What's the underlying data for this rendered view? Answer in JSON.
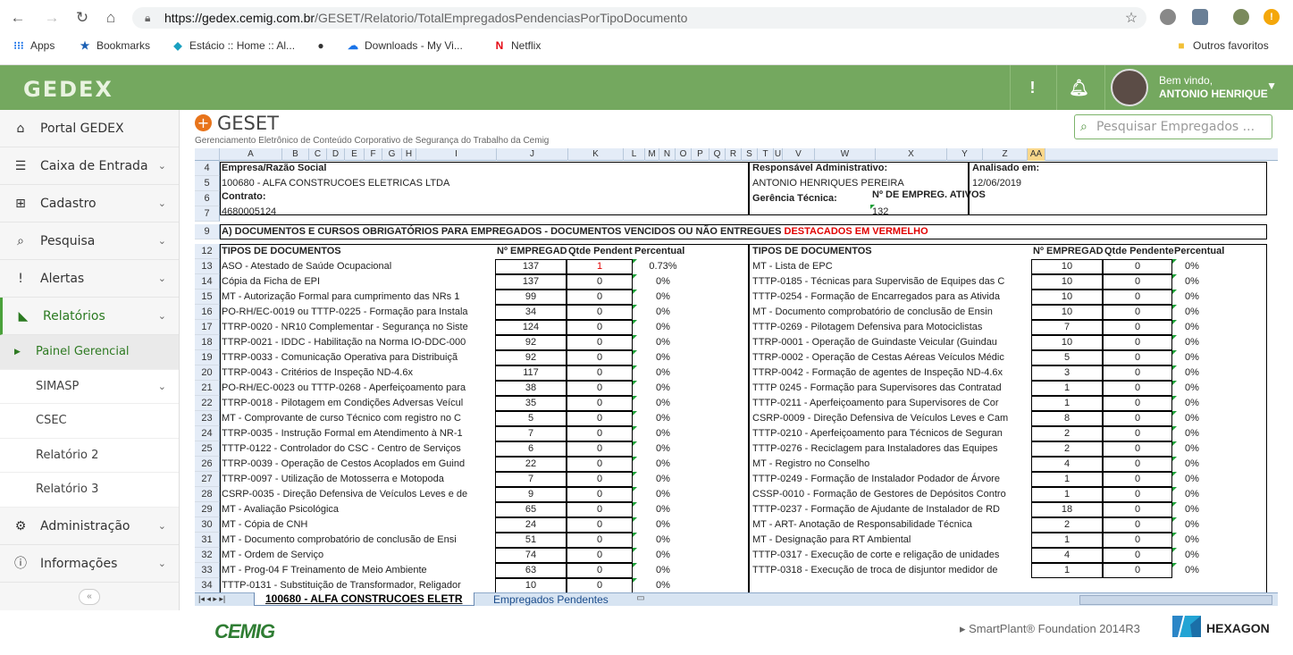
{
  "browser": {
    "url_host": "https://gedex.cemig.com.br",
    "url_path": "/GESET/Relatorio/TotalEmpregadosPendenciasPorTipoDocumento",
    "bookmarks": [
      {
        "icon": "apps-grid-icon",
        "label": "Apps"
      },
      {
        "icon": "star-icon",
        "label": "Bookmarks"
      },
      {
        "icon": "estacio-icon",
        "label": "Estácio :: Home :: Al..."
      },
      {
        "icon": "circle-icon",
        "label": ""
      },
      {
        "icon": "onedrive-icon",
        "label": "Downloads - My Vi..."
      },
      {
        "icon": "netflix-icon",
        "label": "Netflix"
      }
    ],
    "other_favorites": "Outros favoritos"
  },
  "app": {
    "logo": "GEDEX",
    "alert_icon": "!",
    "welcome": "Bem vindo,",
    "user_name": "ANTONIO HENRIQUE"
  },
  "sidebar": {
    "items": [
      {
        "label": "Portal GEDEX"
      },
      {
        "label": "Caixa de Entrada"
      },
      {
        "label": "Cadastro"
      },
      {
        "label": "Pesquisa"
      },
      {
        "label": "Alertas"
      },
      {
        "label": "Relatórios"
      }
    ],
    "subitems": [
      {
        "label": "Painel Gerencial"
      },
      {
        "label": "SIMASP"
      },
      {
        "label": "CSEC"
      },
      {
        "label": "Relatório 2"
      },
      {
        "label": "Relatório 3"
      }
    ],
    "bottom_items": [
      {
        "label": "Administração"
      },
      {
        "label": "Informações"
      }
    ]
  },
  "page": {
    "title": "GESET",
    "subtitle": "Gerenciamento Eletrônico de Conteúdo Corporativo de Segurança do Trabalho da Cemig",
    "search_placeholder": "Pesquisar Empregados ..."
  },
  "sheet": {
    "columns": [
      "A",
      "B",
      "C",
      "D",
      "E",
      "F",
      "G",
      "H",
      "I",
      "J",
      "K",
      "L",
      "M",
      "N",
      "O",
      "P",
      "Q",
      "R",
      "S",
      "T",
      "U",
      "V",
      "W",
      "X",
      "Y",
      "Z",
      "AA"
    ],
    "header": {
      "empresa_label": "Empresa/Razão Social",
      "empresa_value": "100680 - ALFA CONSTRUCOES ELETRICAS LTDA",
      "contrato_label": "Contrato:",
      "contrato_value": "4680005124",
      "resp_label": "Responsável Administrativo:",
      "resp_value": "ANTONIO HENRIQUES PEREIRA",
      "analisado_label": "Analisado em:",
      "analisado_value": "12/06/2019",
      "gerencia_label": "Gerência Técnica:",
      "empreg_label": "Nº DE EMPREG. ATIVOS",
      "empreg_value": "132"
    },
    "section_title": "A) DOCUMENTOS E CURSOS OBRIGATÓRIOS PARA EMPREGADOS - DOCUMENTOS VENCIDOS OU NÃO ENTREGUES",
    "section_highlight": "DESTACADOS EM VERMELHO",
    "col_tipos": "TIPOS DE DOCUMENTOS",
    "col_empreg": "Nº EMPREGAD",
    "col_qtde": "Qtde Pendent",
    "col_perc": "Percentual",
    "col_qtde_r": "Qtde Pendente",
    "col_perc_r": "Percentual",
    "left_rows": [
      {
        "doc": "ASO - Atestado de Saúde Ocupacional",
        "n": "137",
        "q": "1",
        "p": "0.73%"
      },
      {
        "doc": "Cópia da Ficha de EPI",
        "n": "137",
        "q": "0",
        "p": "0%"
      },
      {
        "doc": "MT - Autorização Formal para cumprimento das NRs 1",
        "n": "99",
        "q": "0",
        "p": "0%"
      },
      {
        "doc": "PO-RH/EC-0019 ou TTTP-0225 - Formação para Instala",
        "n": "34",
        "q": "0",
        "p": "0%"
      },
      {
        "doc": "TTRP-0020 - NR10 Complementar - Segurança no Siste",
        "n": "124",
        "q": "0",
        "p": "0%"
      },
      {
        "doc": "TTRP-0021 - IDDC - Habilitação na Norma IO-DDC-000",
        "n": "92",
        "q": "0",
        "p": "0%"
      },
      {
        "doc": "TTRP-0033 - Comunicação Operativa para Distribuiçã",
        "n": "92",
        "q": "0",
        "p": "0%"
      },
      {
        "doc": "TTRP-0043 - Critérios de Inspeção ND-4.6x",
        "n": "117",
        "q": "0",
        "p": "0%"
      },
      {
        "doc": "PO-RH/EC-0023 ou TTTP-0268 - Aperfeiçoamento para",
        "n": "38",
        "q": "0",
        "p": "0%"
      },
      {
        "doc": "TTRP-0018 - Pilotagem em Condições Adversas Veícul",
        "n": "35",
        "q": "0",
        "p": "0%"
      },
      {
        "doc": "MT - Comprovante de curso Técnico com registro no C",
        "n": "5",
        "q": "0",
        "p": "0%"
      },
      {
        "doc": "TTRP-0035 - Instrução Formal em Atendimento à NR-1",
        "n": "7",
        "q": "0",
        "p": "0%"
      },
      {
        "doc": "TTTP-0122 - Controlador do CSC - Centro de Serviços",
        "n": "6",
        "q": "0",
        "p": "0%"
      },
      {
        "doc": "TTRP-0039 - Operação de Cestos Acoplados em Guind",
        "n": "22",
        "q": "0",
        "p": "0%"
      },
      {
        "doc": "TTRP-0097 - Utilização de Motosserra e Motopoda",
        "n": "7",
        "q": "0",
        "p": "0%"
      },
      {
        "doc": "CSRP-0035 - Direção Defensiva de Veículos Leves e de",
        "n": "9",
        "q": "0",
        "p": "0%"
      },
      {
        "doc": "MT - Avaliação Psicológica",
        "n": "65",
        "q": "0",
        "p": "0%"
      },
      {
        "doc": "MT - Cópia de CNH",
        "n": "24",
        "q": "0",
        "p": "0%"
      },
      {
        "doc": "MT - Documento comprobatório de conclusão de Ensi",
        "n": "51",
        "q": "0",
        "p": "0%"
      },
      {
        "doc": "MT - Ordem de Serviço",
        "n": "74",
        "q": "0",
        "p": "0%"
      },
      {
        "doc": "MT - Prog-04 F Treinamento de Meio Ambiente",
        "n": "63",
        "q": "0",
        "p": "0%"
      },
      {
        "doc": "TTTP-0131 - Substituição de Transformador, Religador",
        "n": "10",
        "q": "0",
        "p": "0%"
      }
    ],
    "right_rows": [
      {
        "doc": "MT - Lista de EPC",
        "n": "10",
        "q": "0",
        "p": "0%"
      },
      {
        "doc": "TTTP-0185 - Técnicas para Supervisão de Equipes das C",
        "n": "10",
        "q": "0",
        "p": "0%"
      },
      {
        "doc": "TTTP-0254 - Formação de Encarregados para as Ativida",
        "n": "10",
        "q": "0",
        "p": "0%"
      },
      {
        "doc": "MT - Documento comprobatório de conclusão de Ensin",
        "n": "10",
        "q": "0",
        "p": "0%"
      },
      {
        "doc": "TTTP-0269 - Pilotagem Defensiva para Motociclistas",
        "n": "7",
        "q": "0",
        "p": "0%"
      },
      {
        "doc": "TTRP-0001 - Operação de Guindaste Veicular (Guindau",
        "n": "10",
        "q": "0",
        "p": "0%"
      },
      {
        "doc": "TTRP-0002 - Operação de Cestas Aéreas Veículos Médic",
        "n": "5",
        "q": "0",
        "p": "0%"
      },
      {
        "doc": "TTRP-0042 - Formação de agentes de Inspeção ND-4.6x",
        "n": "3",
        "q": "0",
        "p": "0%"
      },
      {
        "doc": "TTTP 0245 - Formação para Supervisores das Contratad",
        "n": "1",
        "q": "0",
        "p": "0%"
      },
      {
        "doc": "TTTP-0211 - Aperfeiçoamento para Supervisores de Cor",
        "n": "1",
        "q": "0",
        "p": "0%"
      },
      {
        "doc": "CSRP-0009 - Direção Defensiva de Veículos Leves e Cam",
        "n": "8",
        "q": "0",
        "p": "0%"
      },
      {
        "doc": "TTTP-0210 - Aperfeiçoamento para Técnicos de Seguran",
        "n": "2",
        "q": "0",
        "p": "0%"
      },
      {
        "doc": "TTTP-0276 - Reciclagem para Instaladores das Equipes",
        "n": "2",
        "q": "0",
        "p": "0%"
      },
      {
        "doc": "MT - Registro no Conselho",
        "n": "4",
        "q": "0",
        "p": "0%"
      },
      {
        "doc": "TTTP-0249 - Formação de Instalador Podador de Árvore",
        "n": "1",
        "q": "0",
        "p": "0%"
      },
      {
        "doc": "CSSP-0010 - Formação de Gestores de Depósitos Contro",
        "n": "1",
        "q": "0",
        "p": "0%"
      },
      {
        "doc": "TTTP-0237 - Formação de Ajudante de Instalador de RD",
        "n": "18",
        "q": "0",
        "p": "0%"
      },
      {
        "doc": "MT - ART- Anotação de Responsabilidade Técnica",
        "n": "2",
        "q": "0",
        "p": "0%"
      },
      {
        "doc": "MT - Designação para RT Ambiental",
        "n": "1",
        "q": "0",
        "p": "0%"
      },
      {
        "doc": "TTTP-0317 - Execução de corte e religação de unidades",
        "n": "4",
        "q": "0",
        "p": "0%"
      },
      {
        "doc": "TTTP-0318 - Execução de troca de disjuntor medidor de",
        "n": "1",
        "q": "0",
        "p": "0%"
      }
    ],
    "tabs": {
      "active_prefix": "100680 - ALFA CONSTRUCOES ELETR",
      "other": "Empregados Pendentes"
    }
  },
  "footer": {
    "cemig": "CEMIG",
    "product": "▸ SmartPlant® Foundation 2014R3",
    "vendor": "HEXAGON"
  },
  "colors": {
    "green_header": "#74a85f",
    "accent_orange": "#e8741b",
    "highlight_red": "#e10000"
  }
}
